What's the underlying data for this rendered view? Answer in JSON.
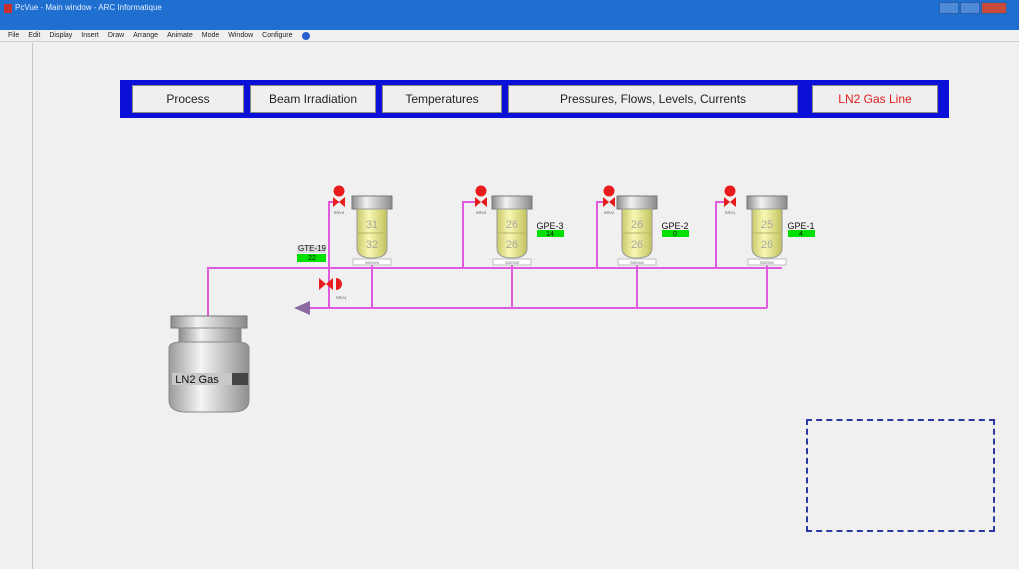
{
  "window": {
    "title": "PcVue - Main window - ARC Informatique",
    "icon": "pcvue-app-icon"
  },
  "menu": [
    "File",
    "Edit",
    "Display",
    "Insert",
    "Draw",
    "Arrange",
    "Animate",
    "Mode",
    "Window",
    "Configure"
  ],
  "nav": {
    "process": "Process",
    "beam": "Beam Irradiation",
    "temperatures": "Temperatures",
    "pressures": "Pressures, Flows, Levels, Currents",
    "ln2": "LN2 Gas Line"
  },
  "colors": {
    "pipe": "#e05ae0",
    "nav_bg": "#0a10d8",
    "value_bg": "#00e000",
    "active_tab": "#e02020",
    "valve": "#e81c1c",
    "dewar_fill": "#efef9c"
  },
  "source": {
    "label": "LN2 Gas",
    "sensor": {
      "tag": "GTE-19",
      "value": "22"
    },
    "valve_label": "SRV4"
  },
  "dewars": [
    {
      "valve": "SRV4",
      "levels": [
        "31",
        "32"
      ],
      "tag": "",
      "value": "",
      "id": "SDEW4"
    },
    {
      "valve": "SRV3",
      "levels": [
        "26",
        "26"
      ],
      "tag": "GPE-3",
      "value": "14",
      "id": "SDEW3"
    },
    {
      "valve": "SRV2",
      "levels": [
        "26",
        "26"
      ],
      "tag": "GPE-2",
      "value": "0",
      "id": "SDEW2"
    },
    {
      "valve": "SRV1",
      "levels": [
        "25",
        "26"
      ],
      "tag": "GPE-1",
      "value": "4",
      "id": "SDEW1"
    }
  ]
}
